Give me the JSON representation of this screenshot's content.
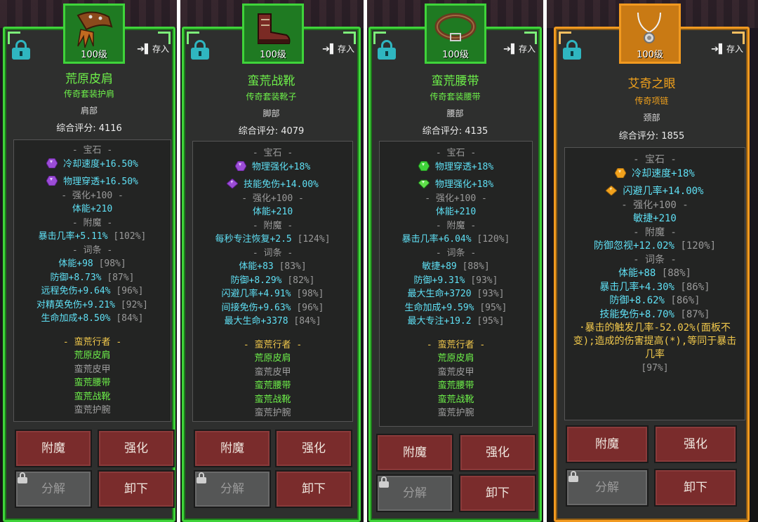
{
  "common": {
    "store_label": "存入",
    "enchant_btn": "附魔",
    "enhance_btn": "强化",
    "dismantle_btn": "分解",
    "unequip_btn": "卸下"
  },
  "colors": {
    "legendary_green": "#3fd43a",
    "legendary_orange": "#f29a20",
    "stat_cyan": "#5fe0f5",
    "set_gold": "#f2c94c",
    "set_active": "#6ef14a",
    "button_red": "#7a2c2c"
  },
  "cards": [
    {
      "level": "100级",
      "item_name": "荒原皮肩",
      "subtitle": "传奇套装护肩",
      "slot": "肩部",
      "score": "综合评分: 4116",
      "gem_header": "- 宝石 -",
      "gems": [
        {
          "text": "冷却速度+16.50%",
          "icon": "purple-gem-icon"
        },
        {
          "text": "物理穿透+16.50%",
          "icon": "purple-gem-icon"
        }
      ],
      "enhance_header": "- 强化+100 -",
      "enhance_stat": "体能+210",
      "enchant_header": "- 附魔 -",
      "enchant_stat": "暴击几率+5.11%",
      "enchant_pct": "[102%]",
      "affix_header": "- 词条 -",
      "affixes": [
        {
          "text": "体能+98",
          "pct": "[98%]"
        },
        {
          "text": "防御+8.73%",
          "pct": "[87%]"
        },
        {
          "text": "远程免伤+9.64%",
          "pct": "[96%]"
        },
        {
          "text": "对精英免伤+9.21%",
          "pct": "[92%]"
        },
        {
          "text": "生命加成+8.50%",
          "pct": "[84%]"
        }
      ],
      "set_name": "- 蛮荒行者 -",
      "set_items": [
        {
          "text": "荒原皮肩",
          "active": true
        },
        {
          "text": "蛮荒皮甲",
          "active": false
        },
        {
          "text": "蛮荒腰带",
          "active": true
        },
        {
          "text": "蛮荒战靴",
          "active": true
        },
        {
          "text": "蛮荒护腕",
          "active": false
        }
      ]
    },
    {
      "level": "100级",
      "item_name": "蛮荒战靴",
      "subtitle": "传奇套装靴子",
      "slot": "脚部",
      "score": "综合评分: 4079",
      "gem_header": "- 宝石 -",
      "gems": [
        {
          "text": "物理强化+18%",
          "icon": "purple-gem-icon"
        },
        {
          "text": "技能免伤+14.00%",
          "icon": "purple-gem-icon"
        }
      ],
      "enhance_header": "- 强化+100 -",
      "enhance_stat": "体能+210",
      "enchant_header": "- 附魔 -",
      "enchant_stat": "每秒专注恢复+2.5",
      "enchant_pct": "[124%]",
      "affix_header": "- 词条 -",
      "affixes": [
        {
          "text": "体能+83",
          "pct": "[83%]"
        },
        {
          "text": "防御+8.29%",
          "pct": "[82%]"
        },
        {
          "text": "闪避几率+4.91%",
          "pct": "[98%]"
        },
        {
          "text": "间接免伤+9.63%",
          "pct": "[96%]"
        },
        {
          "text": "最大生命+3378",
          "pct": "[84%]"
        }
      ],
      "set_name": "- 蛮荒行者 -",
      "set_items": [
        {
          "text": "荒原皮肩",
          "active": true
        },
        {
          "text": "蛮荒皮甲",
          "active": false
        },
        {
          "text": "蛮荒腰带",
          "active": true
        },
        {
          "text": "蛮荒战靴",
          "active": true
        },
        {
          "text": "蛮荒护腕",
          "active": false
        }
      ]
    },
    {
      "level": "100级",
      "item_name": "蛮荒腰带",
      "subtitle": "传奇套装腰带",
      "slot": "腰部",
      "score": "综合评分: 4135",
      "gem_header": "- 宝石 -",
      "gems": [
        {
          "text": "物理穿透+18%",
          "icon": "green-gem-icon"
        },
        {
          "text": "物理强化+18%",
          "icon": "green-gem-icon"
        }
      ],
      "enhance_header": "- 强化+100 -",
      "enhance_stat": "体能+210",
      "enchant_header": "- 附魔 -",
      "enchant_stat": "暴击几率+6.04%",
      "enchant_pct": "[120%]",
      "affix_header": "- 词条 -",
      "affixes": [
        {
          "text": "敏捷+89",
          "pct": "[88%]"
        },
        {
          "text": "防御+9.31%",
          "pct": "[93%]"
        },
        {
          "text": "最大生命+3720",
          "pct": "[93%]"
        },
        {
          "text": "生命加成+9.59%",
          "pct": "[95%]"
        },
        {
          "text": "最大专注+19.2",
          "pct": "[95%]"
        }
      ],
      "set_name": "- 蛮荒行者 -",
      "set_items": [
        {
          "text": "荒原皮肩",
          "active": true
        },
        {
          "text": "蛮荒皮甲",
          "active": false
        },
        {
          "text": "蛮荒腰带",
          "active": true
        },
        {
          "text": "蛮荒战靴",
          "active": true
        },
        {
          "text": "蛮荒护腕",
          "active": false
        }
      ]
    },
    {
      "level": "100级",
      "item_name": "艾奇之眼",
      "subtitle": "传奇项链",
      "slot": "颈部",
      "score": "综合评分: 1855",
      "gem_header": "- 宝石 -",
      "gems": [
        {
          "text": "冷却速度+18%",
          "icon": "orange-gem-icon"
        },
        {
          "text": "闪避几率+14.00%",
          "icon": "orange-gem-icon"
        }
      ],
      "enhance_header": "- 强化+100 -",
      "enhance_stat": "敏捷+210",
      "enchant_header": "- 附魔 -",
      "enchant_stat": "防御忽视+12.02%",
      "enchant_pct": "[120%]",
      "affix_header": "- 词条 -",
      "affixes": [
        {
          "text": "体能+88",
          "pct": "[88%]"
        },
        {
          "text": "暴击几率+4.30%",
          "pct": "[86%]"
        },
        {
          "text": "防御+8.62%",
          "pct": "[86%]"
        },
        {
          "text": "技能免伤+8.70%",
          "pct": "[87%]"
        }
      ],
      "legend_effect": "·暴击的触发几率-52.02%(面板不变);造成的伤害提高(*),等同于暴击几率",
      "legend_pct": "[97%]"
    }
  ]
}
